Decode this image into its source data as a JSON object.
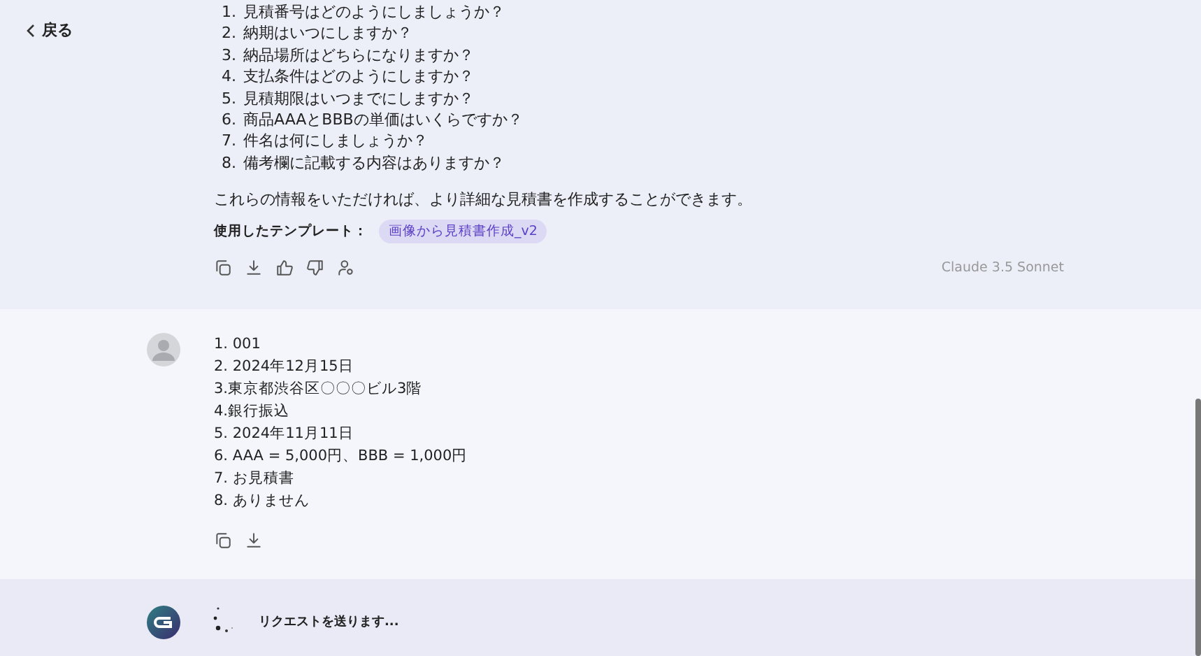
{
  "back_button": {
    "label": "戻る"
  },
  "assistant_message": {
    "questions": [
      {
        "number": "1.",
        "text": "見積番号はどのようにしましょうか？"
      },
      {
        "number": "2.",
        "text": "納期はいつにしますか？"
      },
      {
        "number": "3.",
        "text": "納品場所はどちらになりますか？"
      },
      {
        "number": "4.",
        "text": "支払条件はどのようにしますか？"
      },
      {
        "number": "5.",
        "text": "見積期限はいつまでにしますか？"
      },
      {
        "number": "6.",
        "text": "商品AAAとBBBの単価はいくらですか？"
      },
      {
        "number": "7.",
        "text": "件名は何にしましょうか？"
      },
      {
        "number": "8.",
        "text": "備考欄に記載する内容はありますか？"
      }
    ],
    "closing": "これらの情報をいただければ、より詳細な見積書を作成することができます。",
    "template_label": "使用したテンプレート：",
    "template_tag": "画像から見積書作成_v2",
    "model": "Claude 3.5 Sonnet"
  },
  "user_message": {
    "lines": [
      "1. 001",
      "2. 2024年12月15日",
      "3.東京都渋谷区〇〇〇ビル3階",
      "4.銀行振込",
      "5. 2024年11月11日",
      "6. AAA = 5,000円、BBB = 1,000円",
      "7. お見積書",
      "8. ありません"
    ]
  },
  "pending": {
    "status": "リクエストを送ります..."
  }
}
